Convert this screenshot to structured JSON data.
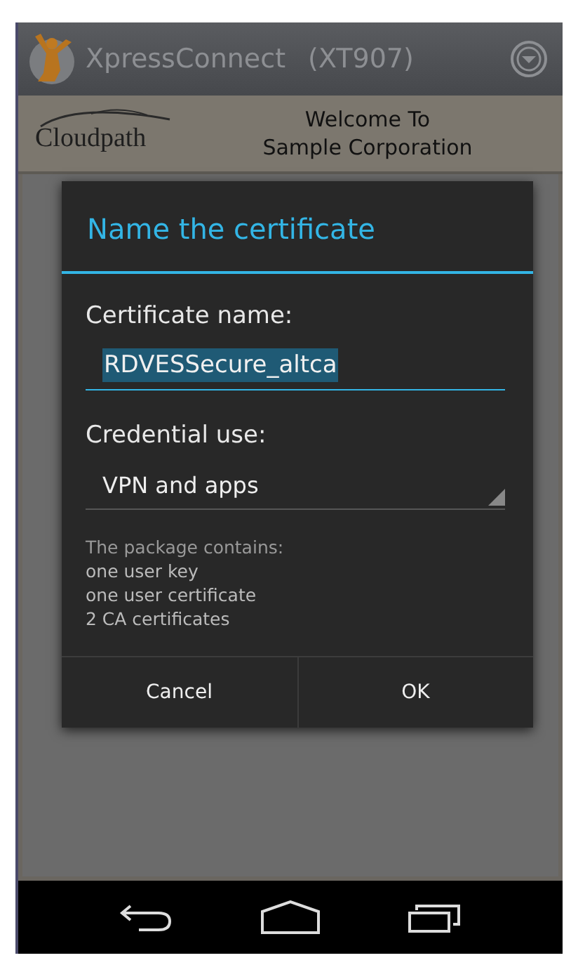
{
  "app_bar": {
    "title": "XpressConnect",
    "model": "(XT907)"
  },
  "header": {
    "logo": "Cloudpath",
    "welcome": [
      "Welcome To",
      "Sample Corporation"
    ]
  },
  "dialog": {
    "title": "Name the certificate",
    "name_label": "Certificate name:",
    "name_value": "RDVESSecure_altca",
    "use_label": "Credential use:",
    "use_value": "VPN and apps",
    "package_lines": [
      "The package contains:",
      "one user key",
      "one user certificate",
      "2 CA certificates"
    ],
    "buttons": [
      "Cancel",
      "OK"
    ]
  }
}
